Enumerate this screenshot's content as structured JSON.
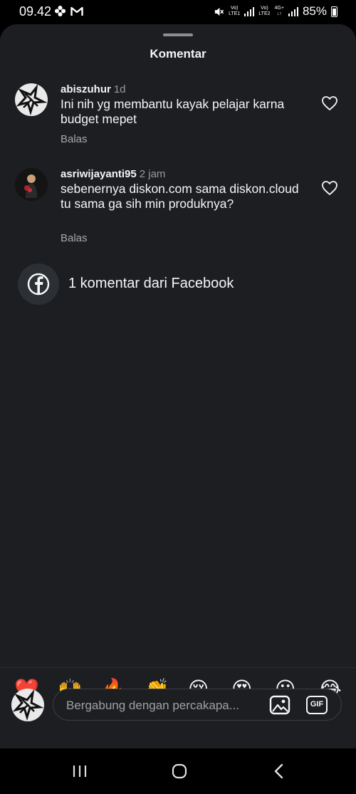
{
  "status_bar": {
    "time": "09.42",
    "battery_percent": "85%",
    "sim1_top": "Vo)",
    "sim1_bottom": "LTE1",
    "sim2_top": "Vo)",
    "sim2_bottom": "LTE2",
    "network_top": "4G+",
    "network_bottom": "↓↑"
  },
  "sheet": {
    "title": "Komentar"
  },
  "comments": [
    {
      "username": "abiszuhur",
      "time": "1d",
      "text": "Ini nih yg membantu kayak pelajar karna budget mepet",
      "reply_label": "Balas"
    },
    {
      "username": "asriwijayanti95",
      "time": "2 jam",
      "text": "sebenernya diskon.com sama diskon.cloud tu sama ga sih min produknya?",
      "reply_label": "Balas"
    }
  ],
  "facebook_comments": {
    "label": "1 komentar dari Facebook"
  },
  "quick_reactions": [
    "❤️",
    "🙌",
    "🔥",
    "👏",
    "😢",
    "😍",
    "😮",
    "😂"
  ],
  "composer": {
    "placeholder": "Bergabung dengan percakapa...",
    "value": "",
    "gif_label": "GIF"
  },
  "colors": {
    "sheet_bg": "#1c1e22",
    "text_primary": "#f5f5f5",
    "text_secondary": "#9a9a9a"
  }
}
